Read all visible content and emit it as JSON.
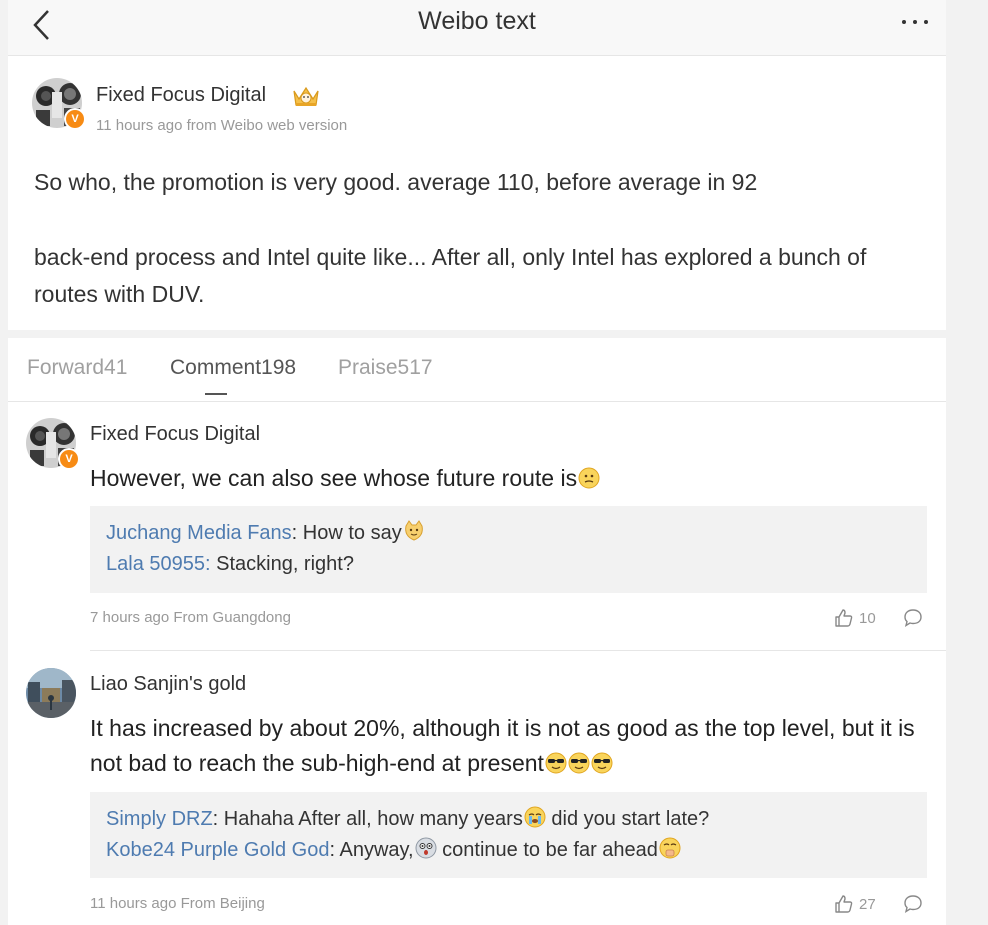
{
  "header": {
    "title": "Weibo text"
  },
  "post": {
    "author": "Fixed Focus Digital",
    "meta": "11 hours ago from Weibo web version",
    "paragraph1": "So who, the promotion is very good. average 110, before average in 92",
    "paragraph2": "back-end process and Intel quite like... After all, only Intel has explored a bunch of routes with DUV."
  },
  "tabs": [
    {
      "label": "Forward41"
    },
    {
      "label": "Comment198"
    },
    {
      "label": "Praise517"
    }
  ],
  "comments": [
    {
      "author": "Fixed Focus Digital",
      "text": "However, we can also see whose future route is",
      "replies": [
        {
          "user": "Juchang Media Fans",
          "sep": ": ",
          "text": "How to say"
        },
        {
          "user": "Lala 50955:",
          "sep": " ",
          "text": "Stacking, right?"
        }
      ],
      "meta": "7 hours ago From Guangdong",
      "likes": "10"
    },
    {
      "author": "Liao Sanjin's gold",
      "text": "It has increased by about 20%, although it is not as good as the top level, but it is not bad to reach the sub-high-end at present",
      "replies": [
        {
          "user": "Simply DRZ",
          "sep": ": ",
          "text": "Hahaha After all, how many years",
          "text2": " did you start late?"
        },
        {
          "user": "Kobe24 Purple Gold God",
          "sep": ": ",
          "text": "Anyway,",
          "text2": " continue to be far ahead"
        }
      ],
      "meta": "11 hours ago From Beijing",
      "likes": "27"
    }
  ],
  "colors": {
    "link": "#4e7bb0",
    "verified_badge": "#f78b14",
    "muted": "#999999"
  },
  "icons": [
    "back-arrow-icon",
    "more-dots-icon",
    "crown-icon",
    "verified-badge-icon",
    "thumbs-up-icon",
    "comment-bubble-icon"
  ]
}
